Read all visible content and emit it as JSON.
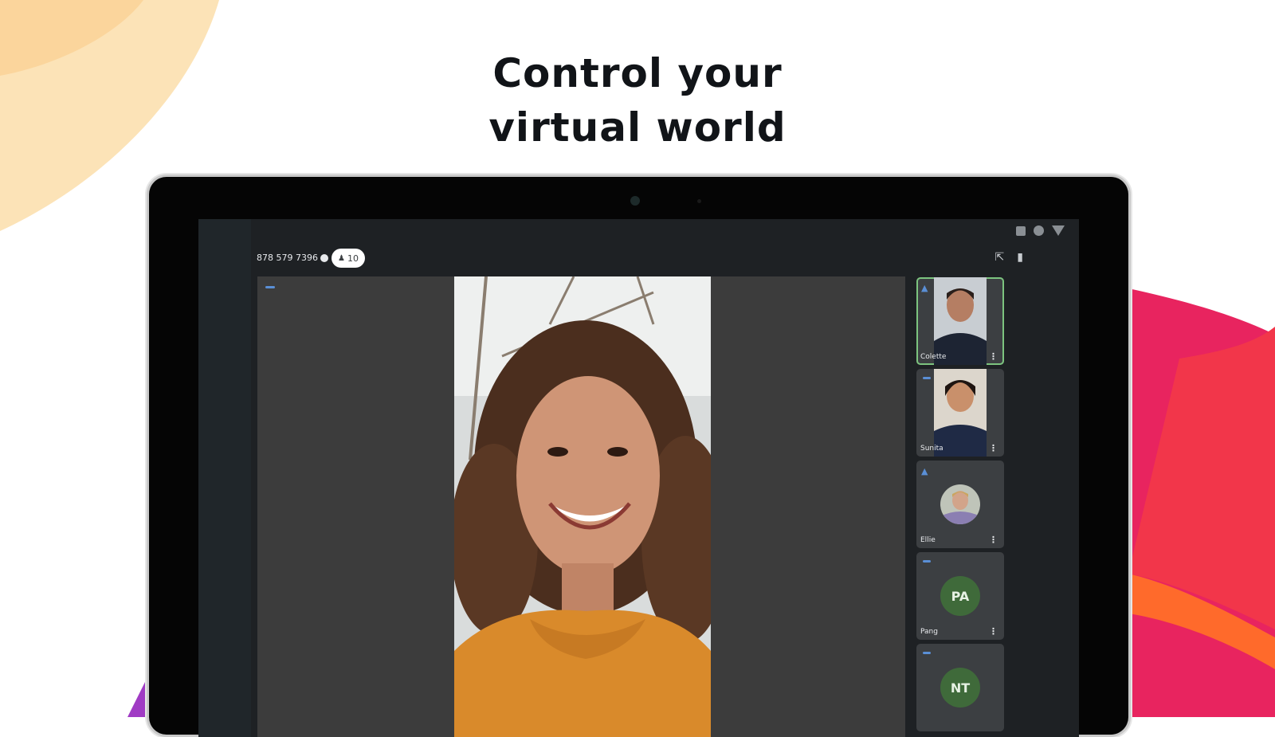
{
  "headline": {
    "line1": "Control your",
    "line2": "virtual world"
  },
  "meeting": {
    "id": "878 579 7396",
    "participant_count": "10"
  },
  "participants": [
    {
      "name": "Colette",
      "avatar": "photo",
      "audio": "speaking",
      "active": true
    },
    {
      "name": "Sunita",
      "avatar": "photo",
      "audio": "muted",
      "active": false
    },
    {
      "name": "Ellie",
      "avatar": "photo",
      "audio": "speaking",
      "active": false
    },
    {
      "name": "Pang",
      "avatar": "initials",
      "initials": "PA",
      "audio": "muted",
      "active": false
    },
    {
      "name": "",
      "avatar": "initials",
      "initials": "NT",
      "audio": "muted",
      "active": false
    }
  ],
  "colors": {
    "accent_green": "#7cc47f",
    "avatar_green": "#3f6a3a",
    "mic_blue": "#5a8fd6",
    "deco_peach": "#fce3b7",
    "deco_pink": "#e8245f",
    "deco_red": "#f2364a",
    "deco_orange": "#ff6a2b",
    "deco_purple": "#a03bc4"
  },
  "icons": {
    "meeting_info": "info-icon",
    "people": "people-icon",
    "switch_camera": "switch-camera-icon",
    "audio": "audio-icon",
    "more": "more-vert-icon",
    "mic": "mic-icon"
  }
}
